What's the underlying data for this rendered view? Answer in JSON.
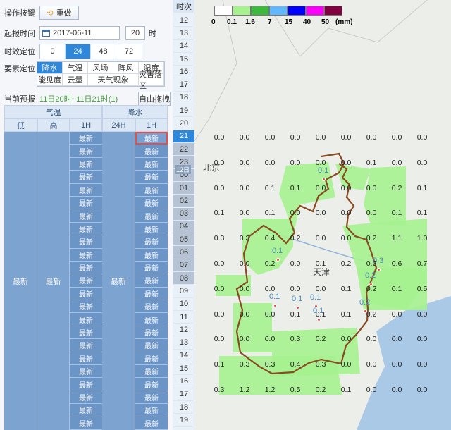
{
  "panel": {
    "ops_label": "操作按键",
    "reset_label": "重做",
    "start_label": "起报时间",
    "date_value": "2017-06-11",
    "hour_value": "20",
    "hour_unit": "时",
    "valid_label": "时效定位",
    "valid_options": [
      "0",
      "24",
      "48",
      "72"
    ],
    "valid_active": "24",
    "element_label": "要素定位",
    "elements": [
      "降水",
      "气温",
      "风场",
      "阵风",
      "湿度",
      "能见度",
      "云量",
      "天气现象",
      "灾害落区"
    ],
    "current_label": "当前预报",
    "current_value": "11日20时~11日21时(1)",
    "free_drag": "自由拖拽"
  },
  "table": {
    "group_temp": "气温",
    "group_precip": "降水",
    "col_low": "低",
    "col_high": "高",
    "col_1h": "1H",
    "col_24h": "24H",
    "col_1h_b": "1H",
    "cell_text": "最新",
    "rows": 23
  },
  "timeline": {
    "header": "时次",
    "hours": [
      "12",
      "13",
      "14",
      "15",
      "16",
      "17",
      "18",
      "19",
      "20",
      "21",
      "22",
      "23",
      "00",
      "01",
      "02",
      "03",
      "04",
      "05",
      "06",
      "07",
      "08",
      "09",
      "10",
      "11",
      "12",
      "13",
      "14",
      "15",
      "16",
      "17",
      "18",
      "19"
    ],
    "active": "21",
    "day_marker": "12日"
  },
  "legend": {
    "colors": [
      "#ffffff",
      "#a6f28f",
      "#3cb93c",
      "#61b8ff",
      "#0000ff",
      "#fa00fa",
      "#800040"
    ],
    "labels": [
      "0",
      "0.1",
      "1.6",
      "7",
      "15",
      "40",
      "50",
      "(mm)"
    ]
  },
  "map": {
    "cities": [
      "北京",
      "天津"
    ],
    "grid": [
      [
        "0.0",
        "0.0",
        "0.0",
        "0.0",
        "0.0",
        "0.0",
        "0.0",
        "0.0",
        "0.0"
      ],
      [
        "0.0",
        "0.0",
        "0.0",
        "0.0",
        "0.0",
        "0.0",
        "0.1",
        "0.0",
        "0.0"
      ],
      [
        "0.0",
        "0.0",
        "0.1",
        "0.1",
        "0.0",
        "0.0",
        "0.0",
        "0.2",
        "0.1"
      ],
      [
        "0.1",
        "0.0",
        "0.1",
        "0.0",
        "0.0",
        "0.0",
        "0.0",
        "0.1",
        "0.1"
      ],
      [
        "0.3",
        "0.3",
        "0.4",
        "0.2",
        "0.0",
        "0.0",
        "0.2",
        "1.1",
        "1.0"
      ],
      [
        "0.0",
        "0.0",
        "0.2",
        "0.0",
        "0.1",
        "0.2",
        "0.2",
        "0.6",
        "0.7"
      ],
      [
        "0.0",
        "0.0",
        "0.0",
        "0.0",
        "0.0",
        "0.1",
        "0.2",
        "0.1",
        "0.5"
      ],
      [
        "0.0",
        "0.0",
        "0.0",
        "0.1",
        "0.1",
        "0.1",
        "0.2",
        "0.0",
        "0.0"
      ],
      [
        "0.0",
        "0.0",
        "0.0",
        "0.3",
        "0.2",
        "0.0",
        "0.0",
        "0.0",
        "0.0"
      ],
      [
        "0.1",
        "0.3",
        "0.3",
        "0.4",
        "0.3",
        "0.0",
        "0.0",
        "0.0",
        "0.0"
      ],
      [
        "0.3",
        "1.2",
        "1.2",
        "0.5",
        "0.2",
        "0.1",
        "0.0",
        "0.0",
        "0.0"
      ]
    ],
    "station_labels": [
      "0.1",
      "0.1",
      "0.1",
      "0.1",
      "0.1",
      "0.1",
      "0.3",
      "0.2",
      "0.2"
    ]
  }
}
